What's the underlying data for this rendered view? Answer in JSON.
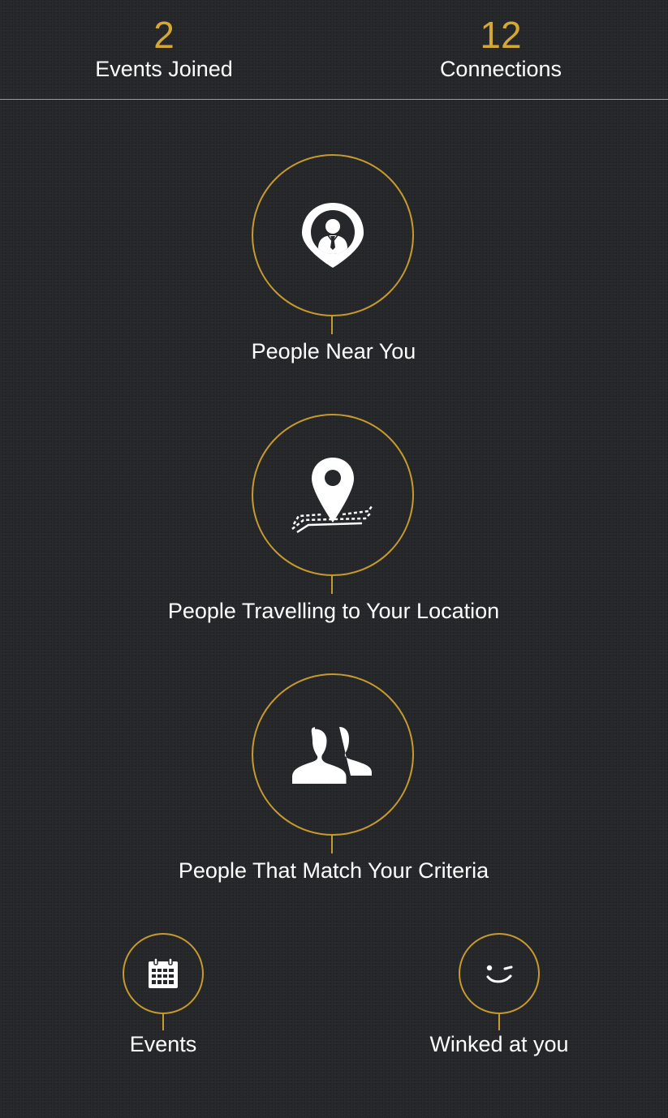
{
  "stats": {
    "events_joined": {
      "value": "2",
      "label": "Events Joined"
    },
    "connections": {
      "value": "12",
      "label": "Connections"
    }
  },
  "menu": {
    "people_near_you": {
      "label": "People Near You",
      "icon": "person-location-pin-icon"
    },
    "people_travelling": {
      "label": "People Travelling to Your Location",
      "icon": "location-route-icon"
    },
    "people_match": {
      "label": "People That Match Your Criteria",
      "icon": "users-icon"
    },
    "events": {
      "label": "Events",
      "icon": "calendar-icon"
    },
    "winked": {
      "label": "Winked at you",
      "icon": "wink-icon"
    }
  },
  "colors": {
    "accent": "#d4a833",
    "ring": "#c79a2e",
    "background": "#25272a",
    "text": "#ffffff"
  }
}
